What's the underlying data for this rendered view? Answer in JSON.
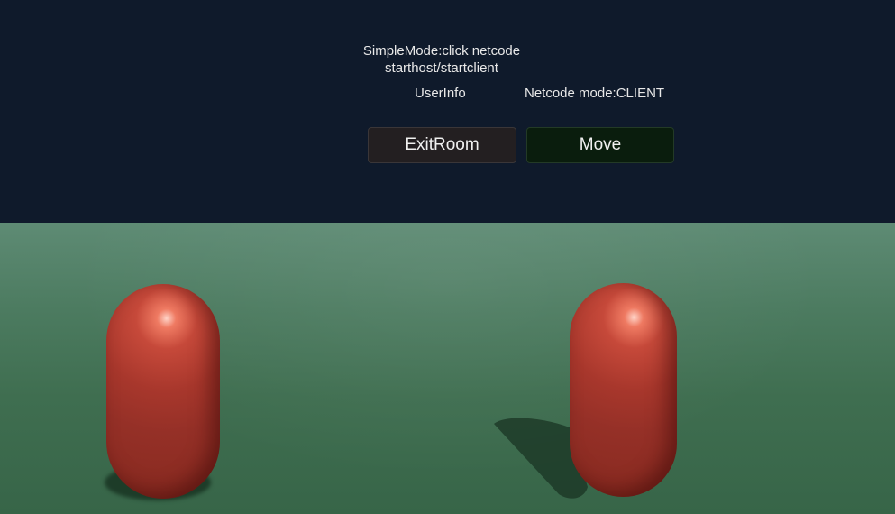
{
  "hud": {
    "hint_line1": "SimpleMode:click netcode",
    "hint_line2": "starthost/startclient",
    "user_info": "UserInfo",
    "netcode_mode": "Netcode mode:CLIENT"
  },
  "buttons": {
    "exit_room": "ExitRoom",
    "move": "Move"
  },
  "colors": {
    "sky": "#0f1a2b",
    "ground": "#4c7b60",
    "capsule": "#a8372c",
    "exit_button_bg": "#231f21",
    "move_button_bg": "#0a1d0d"
  }
}
